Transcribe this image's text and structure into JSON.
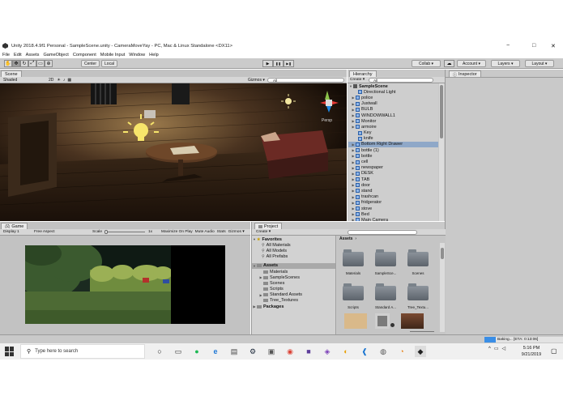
{
  "window": {
    "title": "Unity 2018.4.9f1 Personal - SampleScene.unity - CameraMoveYay - PC, Mac & Linux Standalone <DX11>",
    "controls": {
      "minimize": "−",
      "maximize": "□",
      "close": "✕"
    }
  },
  "menu": [
    "File",
    "Edit",
    "Assets",
    "GameObject",
    "Component",
    "Mobile Input",
    "Window",
    "Help"
  ],
  "toolbar": {
    "pivot": "Center",
    "space": "Local",
    "play": "▶",
    "pause": "❚❚",
    "step": "▶❚",
    "collab": "Collab ▾",
    "account": "Account ▾",
    "layers": "Layers ▾",
    "layout": "Layout ▾"
  },
  "scene": {
    "tab": "Scene",
    "shading": "Shaded",
    "mode2d": "2D",
    "gizmos": "Gizmos ▾",
    "search": "All",
    "persp": "Persp"
  },
  "hierarchy": {
    "tab": "Hierarchy",
    "create": "Create ▾",
    "search": "All",
    "scene_name": "SampleScene",
    "items": [
      {
        "label": "Directional Light",
        "expand": false,
        "selected": false,
        "indent": 2
      },
      {
        "label": "police",
        "expand": true,
        "selected": false,
        "indent": 1
      },
      {
        "label": "Justwall",
        "expand": true,
        "selected": false,
        "indent": 1
      },
      {
        "label": "BULB",
        "expand": true,
        "selected": false,
        "indent": 1
      },
      {
        "label": "WINDOWWALL1",
        "expand": true,
        "selected": false,
        "indent": 1
      },
      {
        "label": "Monitor",
        "expand": true,
        "selected": false,
        "indent": 1
      },
      {
        "label": "armoire",
        "expand": true,
        "selected": false,
        "indent": 1
      },
      {
        "label": "Key",
        "expand": false,
        "selected": false,
        "indent": 2
      },
      {
        "label": "knife",
        "expand": false,
        "selected": false,
        "indent": 2
      },
      {
        "label": "Bottom Right Drawer",
        "expand": true,
        "selected": true,
        "indent": 1
      },
      {
        "label": "bottle (1)",
        "expand": true,
        "selected": false,
        "indent": 1
      },
      {
        "label": "bottle",
        "expand": true,
        "selected": false,
        "indent": 1
      },
      {
        "label": "cell",
        "expand": true,
        "selected": false,
        "indent": 1
      },
      {
        "label": "newspaper",
        "expand": true,
        "selected": false,
        "indent": 1
      },
      {
        "label": "DESK",
        "expand": true,
        "selected": false,
        "indent": 1
      },
      {
        "label": "TAB",
        "expand": true,
        "selected": false,
        "indent": 1
      },
      {
        "label": "door",
        "expand": true,
        "selected": false,
        "indent": 1
      },
      {
        "label": "stand",
        "expand": true,
        "selected": false,
        "indent": 1
      },
      {
        "label": "trashcan",
        "expand": true,
        "selected": false,
        "indent": 1
      },
      {
        "label": "fridgerator",
        "expand": true,
        "selected": false,
        "indent": 1
      },
      {
        "label": "stove",
        "expand": true,
        "selected": false,
        "indent": 1
      },
      {
        "label": "Bed",
        "expand": true,
        "selected": false,
        "indent": 1
      },
      {
        "label": "Main Camera",
        "expand": true,
        "selected": false,
        "indent": 1
      }
    ]
  },
  "inspector": {
    "tab": "Inspector"
  },
  "game": {
    "tab": "Game",
    "display": "Display 1",
    "aspect": "Free Aspect",
    "scale_label": "Scale",
    "scale_value": "1x",
    "maximize": "Maximize On Play",
    "mute": "Mute Audio",
    "stats": "Stats",
    "gizmos": "Gizmos ▾"
  },
  "project": {
    "tab": "Project",
    "create": "Create ▾",
    "favorites_label": "Favorites",
    "favorites": [
      "All Materials",
      "All Models",
      "All Prefabs"
    ],
    "assets_label": "Assets",
    "asset_folders": [
      "Materials",
      "SampleScenes",
      "Scenes",
      "Scripts",
      "Standard Assets",
      "Tree_Textures"
    ],
    "packages_label": "Packages",
    "breadcrumb": "Assets",
    "grid": [
      {
        "label": "Materials",
        "kind": "folder"
      },
      {
        "label": "SampleSce...",
        "kind": "folder"
      },
      {
        "label": "Scenes",
        "kind": "folder"
      },
      {
        "label": "Scripts",
        "kind": "folder"
      },
      {
        "label": "Standard A...",
        "kind": "folder"
      },
      {
        "label": "Tree_Textu...",
        "kind": "folder"
      }
    ]
  },
  "status": {
    "baking": "Baking... [ETA: 0:13:06]"
  },
  "taskbar": {
    "search_placeholder": "Type here to search",
    "time": "5:16 PM",
    "date": "9/21/2019"
  }
}
